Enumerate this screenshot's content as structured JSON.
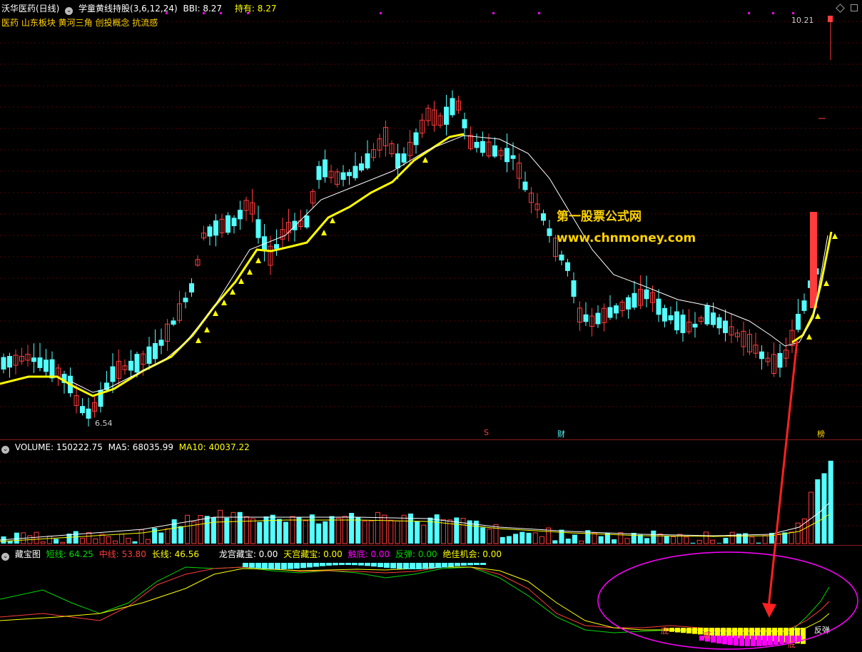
{
  "price_header": {
    "stock": "沃华医药(日线)",
    "indicator": "学童黄线持股(3,6,12,24)",
    "bbi_label": "BBI: 8.27",
    "hold_label": "持有: 8.27"
  },
  "concepts": "医药 山东板块 黄河三角 创投概念 抗流感",
  "watermark": {
    "name": "第一股票公式网",
    "url": "www.chnmoney.com"
  },
  "price_marks": {
    "high": "10.21",
    "low": "6.54"
  },
  "event_marks": {
    "s": "S",
    "cai": "财",
    "rong": "榜"
  },
  "volume_header": {
    "title": "VOLUME: 150222.75",
    "ma5": "MA5: 68035.99",
    "ma10": "MA10: 40037.22"
  },
  "indicator_header": {
    "title": "藏宝图",
    "short": "短线: 64.25",
    "mid": "中线: 53.80",
    "long": "长线: 46.56",
    "longgong": "龙宫藏宝: 0.00",
    "tiangong": "天宫藏宝: 0.00",
    "chudi": "触底: 0.00",
    "fantan": "反弹: 0.00",
    "jue": "绝佳机会: 0.00"
  },
  "indicator_marks": {
    "di1": "底",
    "di2": "底",
    "di3": "底",
    "fantan": "反弹"
  },
  "colors": {
    "up": "#ff3c3c",
    "down": "#54ffff",
    "yellow": "#ffff00",
    "white": "#ffffff",
    "magenta": "#ff00ff",
    "green": "#00d800",
    "bg": "#000000"
  }
}
